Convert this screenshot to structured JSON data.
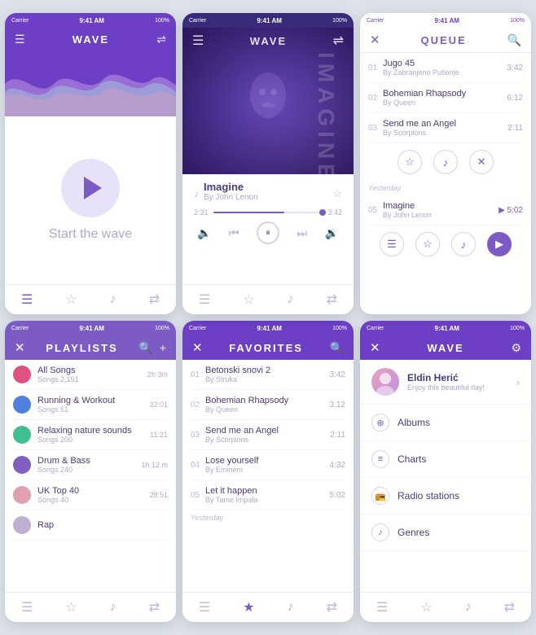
{
  "phones": {
    "wave_player": {
      "status": {
        "carrier": "Carrier",
        "time": "9:41 AM",
        "battery": "100%"
      },
      "header": {
        "title": "WAVE"
      },
      "start_text": "Start the wave",
      "bottom_nav": [
        "menu-icon",
        "star-icon",
        "music-icon",
        "shuffle-icon"
      ]
    },
    "now_playing": {
      "status": {
        "carrier": "Carrier",
        "time": "9:41 AM",
        "battery": "100%"
      },
      "header": {
        "title": "WAVE"
      },
      "imagine_bg": "IMAGINE",
      "song": {
        "title": "Imagine",
        "artist": "By John Lenon",
        "time_elapsed": "2:31",
        "time_total": "3:42"
      },
      "controls": [
        "prev",
        "pause",
        "next"
      ],
      "bottom_nav": [
        "menu-icon",
        "star-icon",
        "music-icon",
        "shuffle-icon"
      ]
    },
    "queue": {
      "status": {
        "carrier": "Carrier",
        "time": "9:41 AM",
        "battery": "100%"
      },
      "header": {
        "title": "QUEUE"
      },
      "songs": [
        {
          "num": "01",
          "title": "Jugo 45",
          "artist": "By Zabranjeno Pušenje",
          "time": "3:42"
        },
        {
          "num": "02",
          "title": "Bohemian Rhapsody",
          "artist": "By Queen",
          "time": "6:12"
        },
        {
          "num": "03",
          "title": "Send me an Angel",
          "artist": "By Scorpions",
          "time": "2:11"
        }
      ],
      "actions1": [
        "star",
        "music",
        "close"
      ],
      "divider": "Yesterday",
      "songs2": [
        {
          "num": "05",
          "title": "Imagine",
          "artist": "By John Lenon",
          "time": "5:02",
          "playing": true
        }
      ],
      "actions2": [
        "menu",
        "star",
        "music",
        "play-filled"
      ],
      "bottom_nav": [
        "menu-icon",
        "star-icon",
        "music-icon",
        "shuffle-icon"
      ]
    },
    "playlists": {
      "status": {
        "carrier": "Carrier",
        "time": "9:41 AM",
        "battery": "100%"
      },
      "header": {
        "title": "PLAYLISTS"
      },
      "items": [
        {
          "name": "All Songs",
          "meta": "Songs 2,151",
          "dur": "2h 3m",
          "color": "#e05080"
        },
        {
          "name": "Running & Workout",
          "meta": "Songs 51",
          "dur": "32:01",
          "color": "#5080e0"
        },
        {
          "name": "Relaxing nature sounds",
          "meta": "Songs 200",
          "dur": "11:21",
          "color": "#40c090"
        },
        {
          "name": "Drum & Bass",
          "meta": "Songs 240",
          "dur": "1h 12 m",
          "color": "#8060c0"
        },
        {
          "name": "UK Top 40",
          "meta": "Songs 40",
          "dur": "28:51",
          "color": "#e0a0b0"
        },
        {
          "name": "Rap",
          "meta": "",
          "dur": "",
          "color": "#c0b0d0"
        }
      ],
      "bottom_nav": [
        "menu-icon",
        "star-icon",
        "music-icon",
        "shuffle-icon"
      ]
    },
    "favorites": {
      "status": {
        "carrier": "Carrier",
        "time": "9:41 AM",
        "battery": "100%"
      },
      "header": {
        "title": "FAVORITES"
      },
      "songs": [
        {
          "num": "01",
          "title": "Betonski snovi 2",
          "artist": "By Struka",
          "time": "3:42"
        },
        {
          "num": "02",
          "title": "Bohemian Rhapsody",
          "artist": "By Queen",
          "time": "3:12"
        },
        {
          "num": "03",
          "title": "Send me an Angel",
          "artist": "By Scorpions",
          "time": "2:11"
        },
        {
          "num": "04",
          "title": "Lose yourself",
          "artist": "By Eminem",
          "time": "4:32"
        },
        {
          "num": "05",
          "title": "Let it happen",
          "artist": "By Tame Impala",
          "time": "5:02"
        }
      ],
      "divider": "Yesterday",
      "bottom_nav": [
        "menu-icon",
        "star-icon",
        "music-icon",
        "shuffle-icon"
      ]
    },
    "wave_menu": {
      "status": {
        "carrier": "Carrier",
        "time": "9:41 AM",
        "battery": "100%"
      },
      "header": {
        "title": "WAVE"
      },
      "profile": {
        "name": "Eldin Herić",
        "greeting": "Enjoy this beautiful day!"
      },
      "menu_items": [
        {
          "label": "Albums",
          "icon": "plus-circle"
        },
        {
          "label": "Charts",
          "icon": "list"
        },
        {
          "label": "Radio stations",
          "icon": "radio"
        },
        {
          "label": "Genres",
          "icon": "note"
        }
      ],
      "bottom_nav": [
        "menu-icon",
        "star-icon",
        "music-icon",
        "shuffle-icon"
      ]
    }
  }
}
